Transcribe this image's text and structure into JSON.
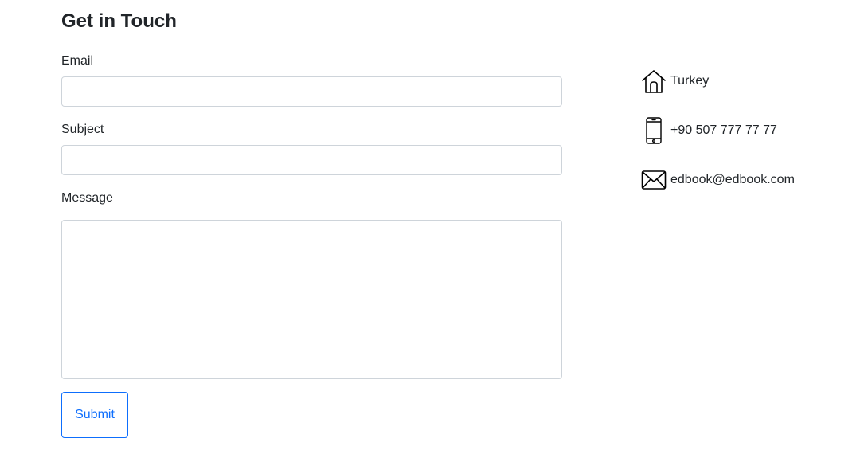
{
  "form": {
    "title": "Get in Touch",
    "email_label": "Email",
    "email_value": "",
    "subject_label": "Subject",
    "subject_value": "",
    "message_label": "Message",
    "message_value": "",
    "submit_label": "Submit"
  },
  "contact": {
    "items": [
      {
        "icon": "house-icon",
        "text": "Turkey"
      },
      {
        "icon": "phone-icon",
        "text": "+90 507 777 77 77"
      },
      {
        "icon": "envelope-icon",
        "text": "edbook@edbook.com"
      }
    ]
  },
  "colors": {
    "text": "#212529",
    "border": "#ced4da",
    "accent": "#0d6efd"
  }
}
